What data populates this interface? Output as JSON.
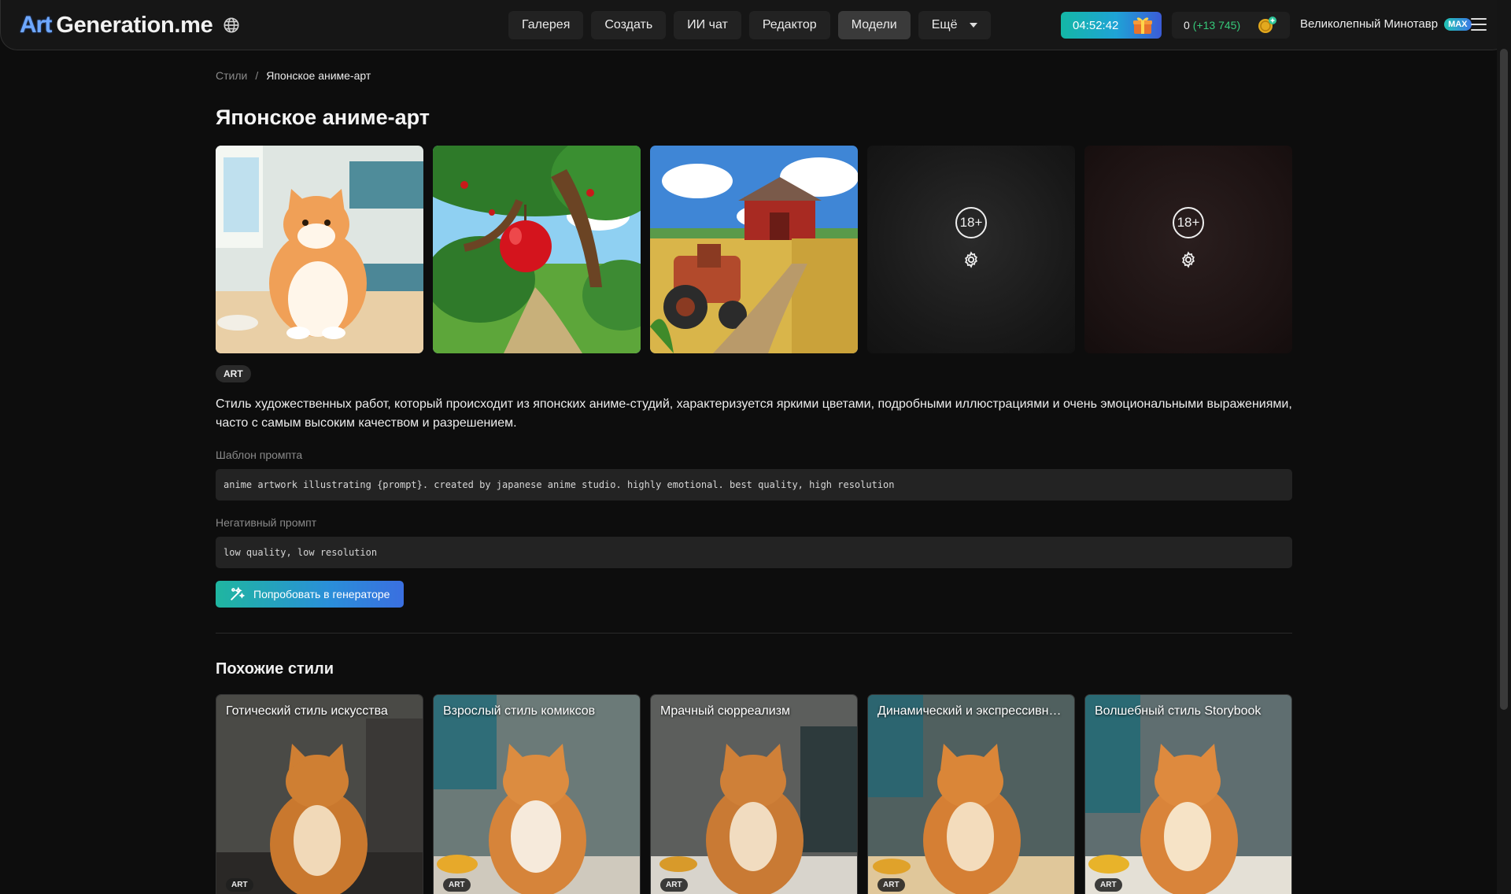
{
  "header": {
    "logo_mark": "Art",
    "logo_text": "Generation.me",
    "nav": [
      {
        "label": "Галерея"
      },
      {
        "label": "Создать"
      },
      {
        "label": "ИИ чат"
      },
      {
        "label": "Редактор"
      },
      {
        "label": "Модели",
        "active": true
      },
      {
        "label": "Ещё"
      }
    ],
    "timer": "04:52:42",
    "balance": "0",
    "balance_plus": "(+13 745)",
    "username": "Великолепный Минотавр",
    "user_badge": "MAX"
  },
  "breadcrumb": {
    "root": "Стили",
    "separator": "/",
    "current": "Японское аниме-арт"
  },
  "page_title": "Японское аниме-арт",
  "gallery": {
    "images": [
      "cat-kitchen",
      "apple-tree",
      "barn-tractor"
    ],
    "nsfw_badge": "18+"
  },
  "tag": "ART",
  "description": "Стиль художественных работ, который происходит из японских аниме-студий, характеризуется яркими цветами, подробными иллюстрациями и очень эмоциональными выражениями, часто с самым высоким качеством и разрешением.",
  "prompt": {
    "label": "Шаблон промпта",
    "value": "anime artwork illustrating {prompt}. created by japanese anime studio. highly emotional. best quality, high resolution"
  },
  "negative": {
    "label": "Негативный промпт",
    "value": "low quality, low resolution"
  },
  "try_button": "Попробовать в генераторе",
  "similar": {
    "title": "Похожие стили",
    "cards": [
      {
        "title": "Готический стиль искусства",
        "tag": "ART"
      },
      {
        "title": "Взрослый стиль комиксов",
        "tag": "ART"
      },
      {
        "title": "Мрачный сюрреализм",
        "tag": "ART"
      },
      {
        "title": "Динамический и экспрессивный стиль",
        "tag": "ART"
      },
      {
        "title": "Волшебный стиль Storybook",
        "tag": "ART"
      }
    ]
  },
  "colors": {
    "background": "#0d0d0d",
    "accent_start": "#1fb6a0",
    "accent_end": "#3a6fe0",
    "balance_plus": "#36c97a"
  }
}
